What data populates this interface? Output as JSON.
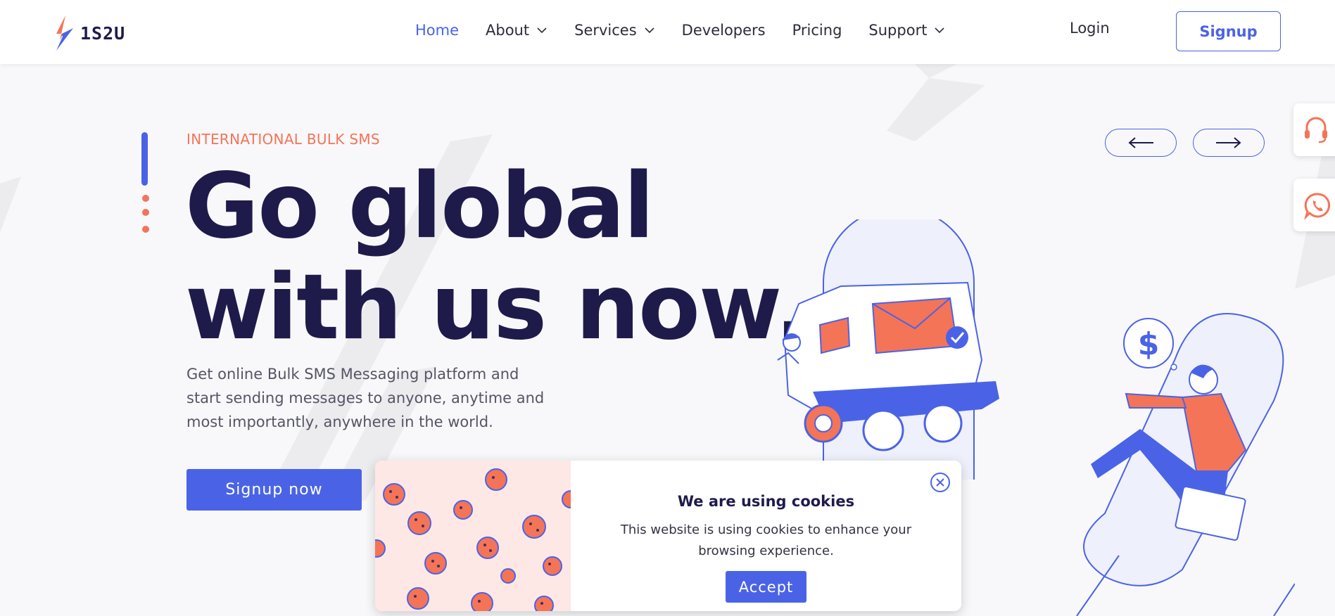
{
  "brand": {
    "name": "1S2U"
  },
  "nav": {
    "items": [
      {
        "label": "Home",
        "active": true,
        "dropdown": false
      },
      {
        "label": "About",
        "active": false,
        "dropdown": true
      },
      {
        "label": "Services",
        "active": false,
        "dropdown": true
      },
      {
        "label": "Developers",
        "active": false,
        "dropdown": false
      },
      {
        "label": "Pricing",
        "active": false,
        "dropdown": false
      },
      {
        "label": "Support",
        "active": false,
        "dropdown": true
      }
    ],
    "login_label": "Login",
    "signup_label": "Signup"
  },
  "hero": {
    "eyebrow": "INTERNATIONAL BULK SMS",
    "headline_line1": "Go global",
    "headline_line2": "with us now.",
    "subtext": "Get online Bulk SMS Messaging platform and start sending messages to anyone, anytime and most importantly, anywhere in the world.",
    "cta_label": "Signup now"
  },
  "side_widgets": {
    "support_icon": "headset-icon",
    "chat_icon": "whatsapp-icon"
  },
  "cookie": {
    "title": "We are using cookies",
    "text": "This website is using cookies to enhance your browsing experience.",
    "accept_label": "Accept"
  },
  "colors": {
    "accent": "#4a63e6",
    "coral": "#f47458",
    "navy": "#1e1b4b",
    "background": "#f8f8fa"
  }
}
